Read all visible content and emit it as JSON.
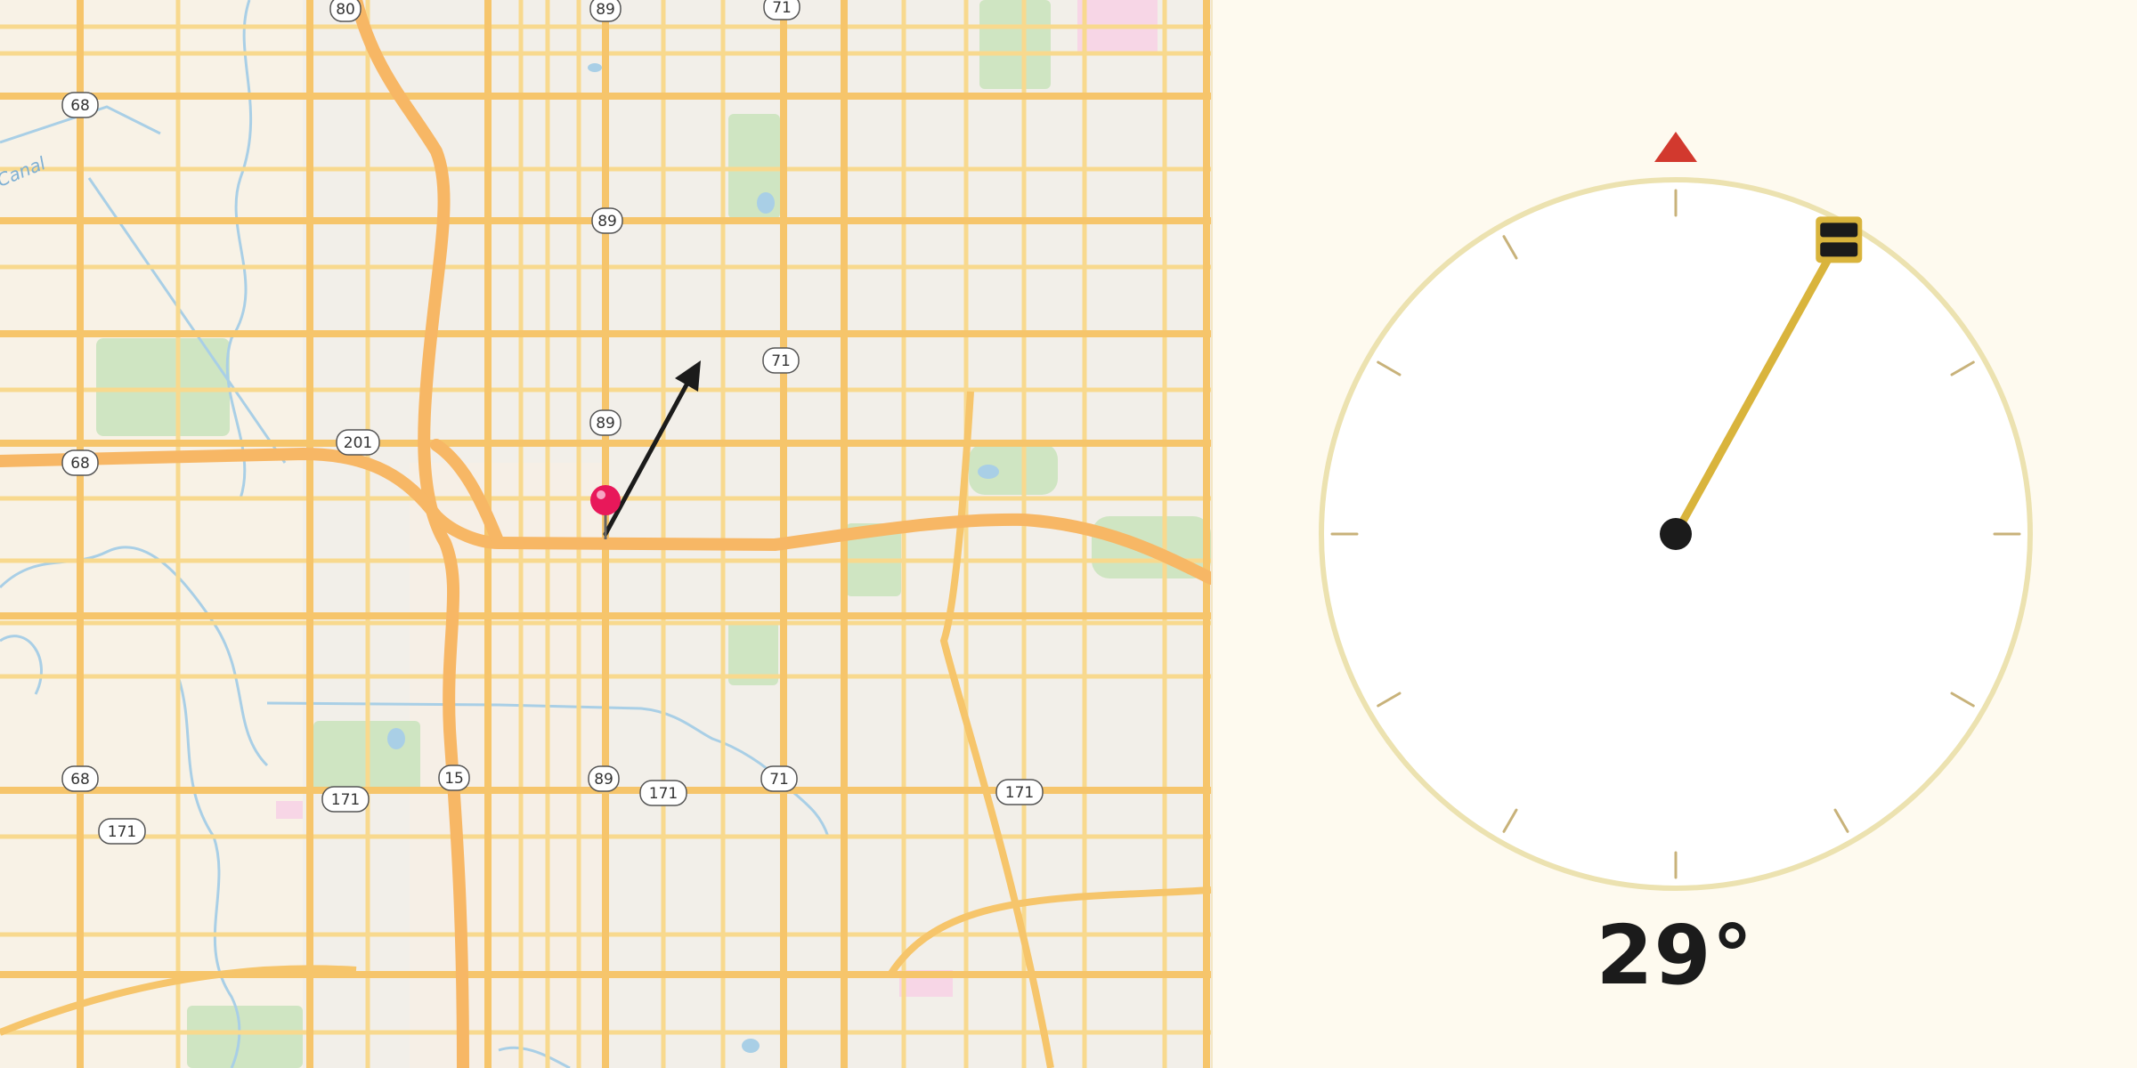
{
  "map": {
    "route_shields": [
      "80",
      "89",
      "71",
      "68",
      "89",
      "71",
      "89",
      "201",
      "68",
      "68",
      "15",
      "89",
      "171",
      "71",
      "171",
      "171",
      "171"
    ],
    "waterway_label": "Canal",
    "colors": {
      "land": "#f2efe9",
      "major_road": "#f6c56b",
      "minor_road": "#f8d98e",
      "highway": "#f7b765",
      "park": "#c9e2bd",
      "water": "#9ecbe8",
      "pin": "#e8185a"
    },
    "pin": {
      "icon": "map-pin-icon"
    },
    "direction_arrow": {
      "icon": "arrow-icon",
      "heading_deg": 29
    }
  },
  "compass": {
    "heading_deg": 29,
    "heading_label": "29°",
    "north_marker": {
      "icon": "north-triangle-icon",
      "color": "#d2392e"
    },
    "needle_color": "#d9b43c",
    "ring_color": "#ece2b0",
    "handle_icon": "drag-handle-icon"
  }
}
